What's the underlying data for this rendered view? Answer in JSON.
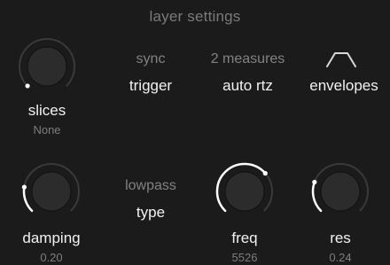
{
  "header": {
    "title": "layer settings"
  },
  "colors": {
    "background": "#1b1b1b",
    "knob_body": "#2c2c2c",
    "track": "#3a3a3a",
    "active_arc": "#ffffff"
  },
  "row1": {
    "slices": {
      "label": "slices",
      "value": "None",
      "level": 0.0
    },
    "sync": {
      "caption": "sync",
      "value": "trigger"
    },
    "length": {
      "caption": "2 measures",
      "value": "auto rtz"
    },
    "envelopes": {
      "icon": "envelope-shape-icon",
      "label": "envelopes"
    }
  },
  "row2": {
    "damping": {
      "label": "damping",
      "value": "0.20",
      "level": 0.2
    },
    "filter": {
      "caption": "lowpass",
      "value": "type"
    },
    "freq": {
      "label": "freq",
      "value": "5526",
      "level": 0.68
    },
    "res": {
      "label": "res",
      "value": "0.24",
      "level": 0.24
    }
  }
}
